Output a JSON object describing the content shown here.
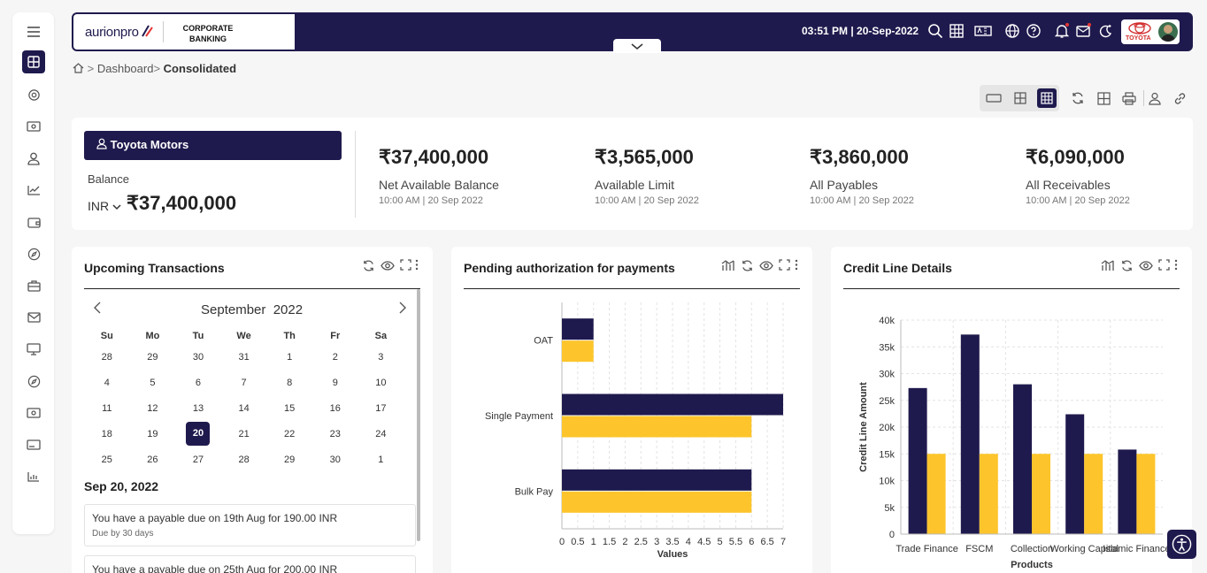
{
  "header": {
    "brand": "aurionpro",
    "product_line1": "CORPORATE",
    "product_line2": "BANKING",
    "datetime": "03:51 PM | 20-Sep-2022",
    "org_logo_text": "TOYOTA"
  },
  "icons": {
    "sidebar": [
      "menu-icon",
      "dashboard-icon",
      "settings-icon",
      "payments-icon",
      "user-icon",
      "analytics-icon",
      "wallet-icon",
      "compass-icon",
      "briefcase-icon",
      "mail-icon",
      "monitor-icon",
      "compass-icon",
      "cash-icon",
      "card-icon",
      "report-icon"
    ],
    "topbar": [
      "search-icon",
      "grid-icon",
      "card-icon",
      "globe-icon",
      "help-icon",
      "bell-icon",
      "mail-icon",
      "theme-icon"
    ]
  },
  "breadcrumb": {
    "home": "",
    "item1": "Dashboard",
    "item2": "Consolidated"
  },
  "summary": {
    "account": "Toyota Motors",
    "balance_label": "Balance",
    "currency": "INR",
    "balance_value": "₹37,400,000",
    "stats": [
      {
        "value": "₹37,400,000",
        "label": "Net Available Balance",
        "time": "10:00 AM | 20 Sep 2022"
      },
      {
        "value": "₹3,565,000",
        "label": "Available Limit",
        "time": "10:00 AM | 20 Sep 2022"
      },
      {
        "value": "₹3,860,000",
        "label": "All Payables",
        "time": "10:00 AM | 20 Sep 2022"
      },
      {
        "value": "₹6,090,000",
        "label": "All Receivables",
        "time": "10:00 AM | 20 Sep 2022"
      }
    ]
  },
  "upcoming": {
    "title": "Upcoming Transactions",
    "month": "September",
    "year": "2022",
    "weekdays": [
      "Su",
      "Mo",
      "Tu",
      "We",
      "Th",
      "Fr",
      "Sa"
    ],
    "weeks": [
      [
        "28",
        "29",
        "30",
        "31",
        "1",
        "2",
        "3"
      ],
      [
        "4",
        "5",
        "6",
        "7",
        "8",
        "9",
        "10"
      ],
      [
        "11",
        "12",
        "13",
        "14",
        "15",
        "16",
        "17"
      ],
      [
        "18",
        "19",
        "20",
        "21",
        "22",
        "23",
        "24"
      ],
      [
        "25",
        "26",
        "27",
        "28",
        "29",
        "30",
        "1"
      ]
    ],
    "selected_day": "20",
    "date_heading": "Sep 20, 2022",
    "notes": [
      {
        "msg": "You have a payable due on 19th Aug for 190.00 INR",
        "sub": "Due by 30 days"
      },
      {
        "msg": "You have a payable due on 25th Aug for 200.00 INR",
        "sub": ""
      }
    ]
  },
  "pending": {
    "title": "Pending authorization for payments",
    "chart_data": {
      "type": "bar",
      "orientation": "horizontal",
      "categories": [
        "OAT",
        "Single Payment",
        "Bulk Pay"
      ],
      "series": [
        {
          "color": "#1f1a4d",
          "values": [
            1,
            7,
            6
          ]
        },
        {
          "color": "#fdc52b",
          "values": [
            1,
            6,
            6
          ]
        }
      ],
      "xlabel": "Values",
      "xlim": [
        0,
        7
      ],
      "xticks": [
        "0",
        "0.5",
        "1",
        "1.5",
        "2",
        "2.5",
        "3",
        "3.5",
        "4",
        "4.5",
        "5",
        "5.5",
        "6",
        "6.5",
        "7"
      ],
      "grid": true
    }
  },
  "credit": {
    "title": "Credit Line Details",
    "chart_data": {
      "type": "bar",
      "categories": [
        "Trade Finance",
        "FSCM",
        "Collection",
        "Working Capital",
        "Islamic Finance"
      ],
      "tick_labels": [
        "Trade Finance",
        "FSCM",
        "Collection",
        "Working Capital",
        "Islamic Finance"
      ],
      "series": [
        {
          "color": "#1f1a4d",
          "values": [
            27300,
            37300,
            28000,
            22400,
            15800
          ]
        },
        {
          "color": "#fdc52b",
          "values": [
            15000,
            15000,
            15000,
            15000,
            15000
          ]
        }
      ],
      "xlabel": "Products",
      "ylabel": "Credit Line Amount",
      "ylim": [
        0,
        40000
      ],
      "yticks": [
        "0",
        "5k",
        "10k",
        "15k",
        "20k",
        "25k",
        "30k",
        "35k",
        "40k"
      ],
      "grid": true
    }
  },
  "colors": {
    "primary": "#1f1a4d",
    "accent": "#fdc52b",
    "alert": "#e53935"
  }
}
